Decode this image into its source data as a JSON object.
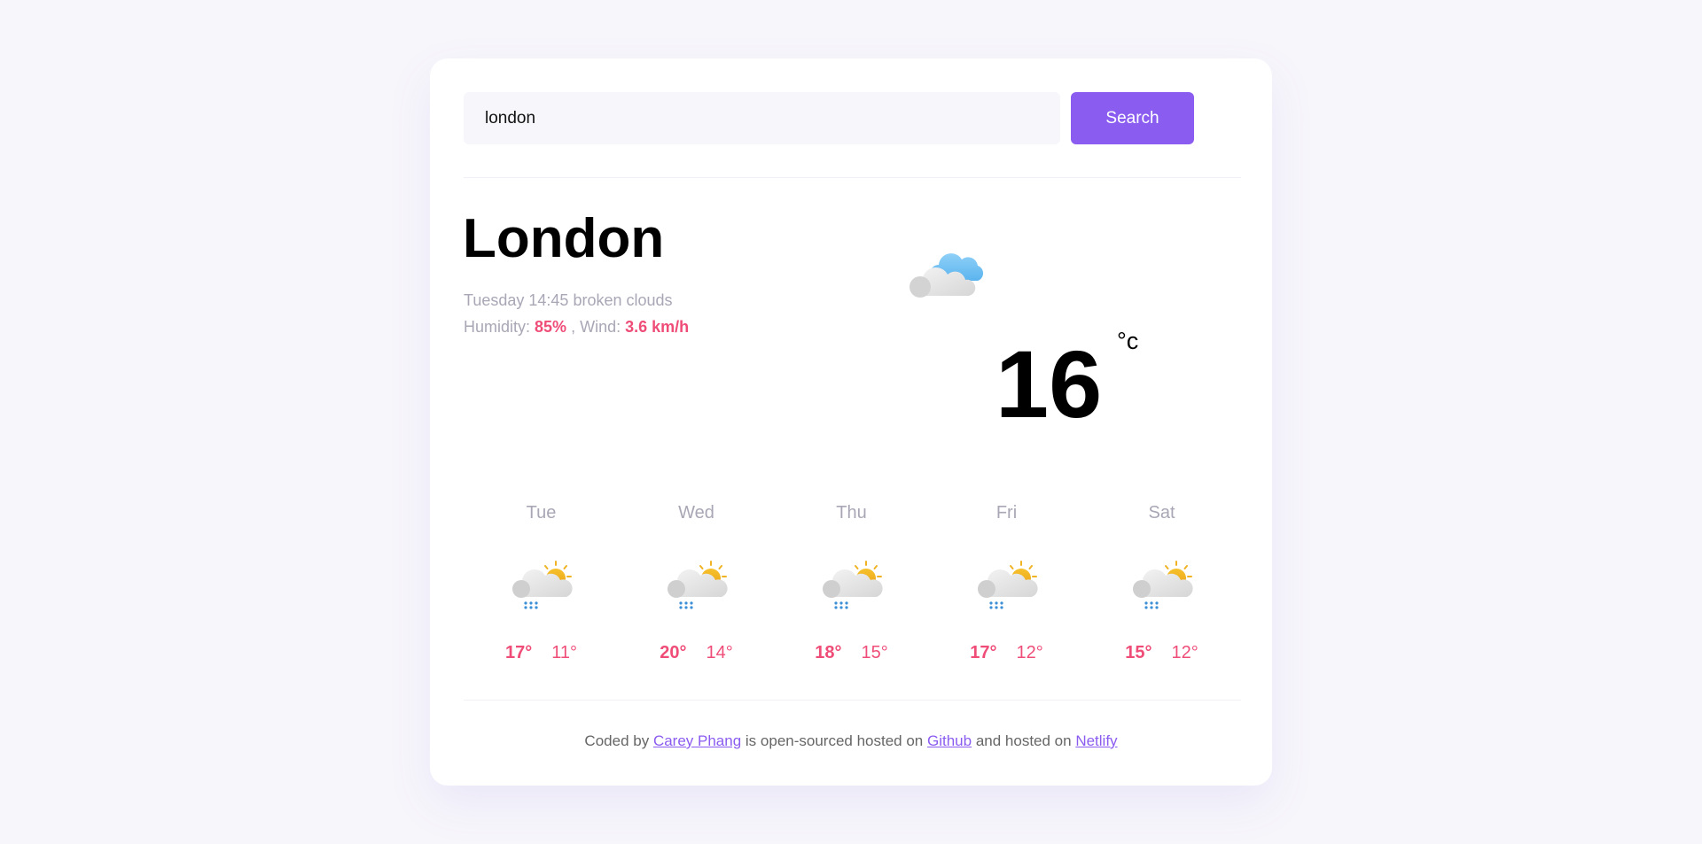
{
  "search": {
    "value": "london",
    "button_label": "Search"
  },
  "current": {
    "city": "London",
    "day": "Tuesday",
    "time": "14:45",
    "description": "broken clouds",
    "humidity_label": "Humidity:",
    "humidity": "85%",
    "wind_label": ", Wind:",
    "wind": "3.6 km/h",
    "icon": "broken-clouds-icon",
    "temperature": "16",
    "unit": "°c"
  },
  "forecast": [
    {
      "day": "Tue",
      "icon": "sun-cloud-rain-icon",
      "max": "17°",
      "min": "11°"
    },
    {
      "day": "Wed",
      "icon": "sun-cloud-rain-icon",
      "max": "20°",
      "min": "14°"
    },
    {
      "day": "Thu",
      "icon": "sun-cloud-rain-icon",
      "max": "18°",
      "min": "15°"
    },
    {
      "day": "Fri",
      "icon": "sun-cloud-rain-icon",
      "max": "17°",
      "min": "12°"
    },
    {
      "day": "Sat",
      "icon": "sun-cloud-rain-icon",
      "max": "15°",
      "min": "12°"
    }
  ],
  "footer": {
    "prefix": "Coded by",
    "author": "Carey Phang",
    "middle": "is open-sourced hosted on",
    "github": "Github",
    "and": "and hosted on",
    "netlify": "Netlify"
  },
  "colors": {
    "accent": "#8b5cf0",
    "highlight": "#ef4d78",
    "muted": "#a9a7b5",
    "background": "#f7f6fb"
  }
}
